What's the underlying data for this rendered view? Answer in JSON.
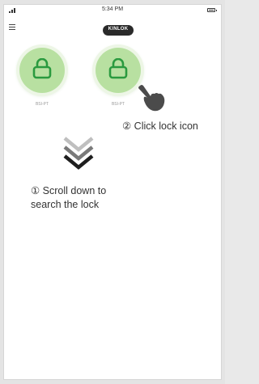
{
  "status_bar": {
    "time": "5:34 PM",
    "signal_icon": "signal-icon",
    "battery_icon": "battery-icon"
  },
  "app_bar": {
    "menu_icon": "hamburger-menu-icon",
    "logo_text": "KINLOK"
  },
  "locks": [
    {
      "label": "BSI-PT",
      "icon": "lock-icon"
    },
    {
      "label": "BSI-PT",
      "icon": "lock-icon"
    }
  ],
  "instructions": {
    "step_two": "② Click lock icon",
    "step_one_line1": "① Scroll down to",
    "step_one_line2": "search the lock"
  },
  "colors": {
    "lock_fill": "#b8e0a1",
    "lock_icon": "#2a9a3f",
    "chevron_light": "#bfbfbf",
    "chevron_mid": "#7a7a7a",
    "chevron_dark": "#1e1e1e"
  }
}
